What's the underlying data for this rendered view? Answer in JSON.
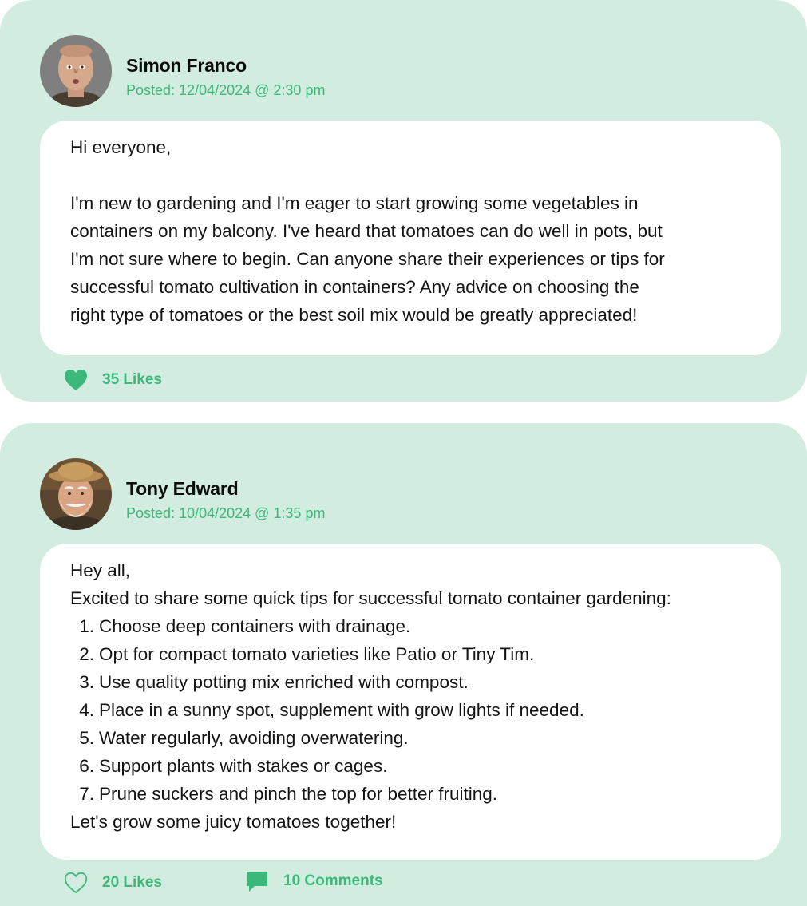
{
  "posts": [
    {
      "author": "Simon Franco",
      "posted": "Posted: 12/04/2024 @ 2:30 pm",
      "avatar": "avatar-photo",
      "body": {
        "greeting": "Hi everyone,",
        "lines": [
          "I'm new to gardening and I'm eager to start growing some vegetables in",
          "containers on my balcony. I've heard that tomatoes can do well in pots, but",
          "I'm not sure where to begin. Can anyone share their experiences or tips for",
          "successful tomato cultivation in containers? Any advice on choosing the",
          "right type of tomatoes or the best soil mix would be greatly appreciated!"
        ]
      },
      "likes_label": "35 Likes",
      "like_icon": "heart-filled-icon",
      "liked": true
    },
    {
      "author": "Tony Edward",
      "posted": "Posted: 10/04/2024 @ 1:35 pm",
      "avatar": "avatar-photo",
      "body": {
        "greeting": "Hey all,",
        "intro": "Excited to share some quick tips for successful tomato container gardening:",
        "tips": [
          {
            "num": "1.",
            "text": "Choose deep containers with drainage."
          },
          {
            "num": "2.",
            "text": "Opt for compact tomato varieties like Patio or Tiny Tim."
          },
          {
            "num": "3.",
            "text": "Use quality potting mix enriched with compost."
          },
          {
            "num": "4.",
            "text": "Place in a sunny spot, supplement with grow lights if needed."
          },
          {
            "num": "5.",
            "text": "Water regularly, avoiding overwatering."
          },
          {
            "num": "6.",
            "text": "Support plants with stakes or cages."
          },
          {
            "num": "7.",
            "text": "Prune suckers and pinch the top for better fruiting."
          }
        ],
        "outro": "Let's grow some juicy tomatoes together!"
      },
      "likes_label": "20 Likes",
      "like_icon": "heart-outline-icon",
      "liked": false,
      "comments_label": "10 Comments",
      "comment_icon": "comment-bubble-icon"
    }
  ],
  "colors": {
    "card_bg": "#d2ede0",
    "accent": "#3cb97a",
    "bubble_bg": "#ffffff"
  }
}
